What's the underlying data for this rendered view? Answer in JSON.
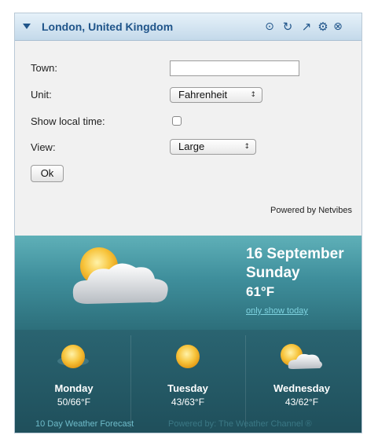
{
  "header": {
    "title": "London, United Kingdom",
    "icons": [
      "collapse-icon",
      "options-circle-icon",
      "refresh-icon",
      "share-arrow-icon",
      "settings-gear-icon",
      "close-circle-icon"
    ]
  },
  "form": {
    "town_label": "Town:",
    "town_value": "",
    "unit_label": "Unit:",
    "unit_value": "Fahrenheit",
    "local_time_label": "Show local time:",
    "local_time_checked": false,
    "view_label": "View:",
    "view_value": "Large",
    "ok_label": "Ok",
    "powered_by": "Powered by Netvibes"
  },
  "today": {
    "date": "16 September",
    "day": "Sunday",
    "temp": "61°F",
    "link": "only show today",
    "condition_icon": "sun-behind-cloud-icon"
  },
  "forecast": [
    {
      "day": "Monday",
      "temp": "50/66°F",
      "icon": "sun-icon"
    },
    {
      "day": "Tuesday",
      "temp": "43/63°F",
      "icon": "sun-icon"
    },
    {
      "day": "Wednesday",
      "temp": "43/62°F",
      "icon": "partly-cloudy-icon"
    }
  ],
  "footer": {
    "forecast_link": "10 Day Weather Forecast",
    "powered_by": "Powered by: The Weather Channel ®"
  },
  "colors": {
    "title_text": "#20558a",
    "weather_top": "#3f8f9c",
    "weather_bottom": "#245a66"
  }
}
